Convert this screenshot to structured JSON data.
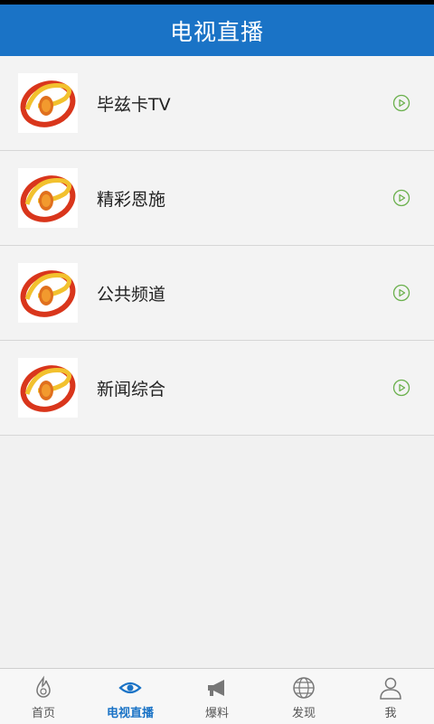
{
  "header": {
    "title": "电视直播"
  },
  "channels": [
    {
      "name": "毕兹卡TV",
      "logo_icon": "channel-logo-e-icon",
      "action_icon": "play-circle-icon"
    },
    {
      "name": "精彩恩施",
      "logo_icon": "channel-logo-e-icon",
      "action_icon": "play-circle-icon"
    },
    {
      "name": "公共频道",
      "logo_icon": "channel-logo-e-icon",
      "action_icon": "play-circle-icon"
    },
    {
      "name": "新闻综合",
      "logo_icon": "channel-logo-e-icon",
      "action_icon": "play-circle-icon"
    }
  ],
  "tabbar": {
    "items": [
      {
        "label": "首页",
        "icon": "home-flame-icon",
        "active": false
      },
      {
        "label": "电视直播",
        "icon": "eye-icon",
        "active": true
      },
      {
        "label": "爆料",
        "icon": "megaphone-icon",
        "active": false
      },
      {
        "label": "发现",
        "icon": "globe-icon",
        "active": false
      },
      {
        "label": "我",
        "icon": "user-icon",
        "active": false
      }
    ]
  },
  "colors": {
    "header_bg": "#1a73c6",
    "accent": "#1a73c6",
    "play_icon": "#6ab04c"
  }
}
